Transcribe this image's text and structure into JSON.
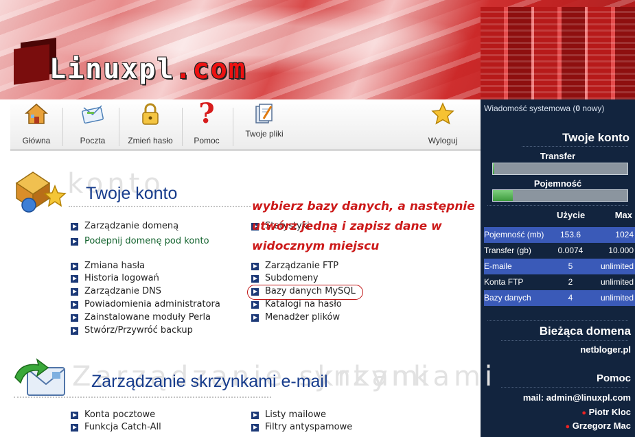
{
  "header": {
    "logo_main": "Linuxpl",
    "logo_dot": ".com"
  },
  "toolbar": [
    {
      "label": "Główna",
      "icon": "home-icon"
    },
    {
      "label": "Poczta",
      "icon": "mail-icon"
    },
    {
      "label": "Zmień hasło",
      "icon": "lock-icon"
    },
    {
      "label": "Pomoc",
      "icon": "help-icon"
    },
    {
      "label": "Twoje pliki",
      "icon": "files-icon"
    },
    {
      "label": "Wyloguj",
      "icon": "star-icon"
    }
  ],
  "sidebar": {
    "system_msg_prefix": "Wiadomość systemowa (",
    "system_msg_count": "0",
    "system_msg_suffix": " nowy)",
    "account_title": "Twoje konto",
    "transfer_label": "Transfer",
    "transfer_fill": 0.01,
    "capacity_label": "Pojemność",
    "capacity_fill": 0.15,
    "col_usage": "Użycie",
    "col_max": "Max",
    "stats": [
      {
        "name": "Pojemność (mb)",
        "usage": "153.6",
        "max": "1024",
        "highlight": true
      },
      {
        "name": "Transfer (gb)",
        "usage": "0.0074",
        "max": "10.000",
        "highlight": false
      },
      {
        "name": "E-maile",
        "usage": "5",
        "max": "unlimited",
        "highlight": true
      },
      {
        "name": "Konta FTP",
        "usage": "2",
        "max": "unlimited",
        "highlight": false
      },
      {
        "name": "Bazy danych",
        "usage": "4",
        "max": "unlimited",
        "highlight": true
      }
    ],
    "domain_title": "Bieżąca domena",
    "domain_value": "netbloger.pl",
    "help_title": "Pomoc",
    "help_mail": "mail: admin@linuxpl.com",
    "contacts": [
      "Piotr Kloc",
      "Grzegorz Mac"
    ]
  },
  "account_section": {
    "ghost": "konto",
    "title": "Twoje konto",
    "left_links": [
      "Zarządzanie domeną",
      "Podepnij domenę pod konto",
      "Zmiana hasła",
      "Historia logowań",
      "Zarządzanie DNS",
      "Powiadomienia administratora",
      "Zainstalowane moduły Perla",
      "Stwórz/Przywróć backup"
    ],
    "right_links": [
      "Statystyki",
      "Zarządzanie FTP",
      "Subdomeny",
      "Bazy danych MySQL",
      "Katalogi na hasło",
      "Menadżer plików"
    ]
  },
  "annotation": {
    "line1": "wybierz bazy danych, a następnie",
    "line2": "utwórz jedną i zapisz dane w",
    "line3": "widocznym miejscu"
  },
  "mail_section": {
    "ghost": "Zarządzanie skrzynkami",
    "title": "Zarządzanie skrzynkami e-mail",
    "left_links": [
      "Konta pocztowe",
      "Funkcja Catch-All"
    ],
    "right_links": [
      "Listy mailowe",
      "Filtry antyspamowe"
    ]
  }
}
